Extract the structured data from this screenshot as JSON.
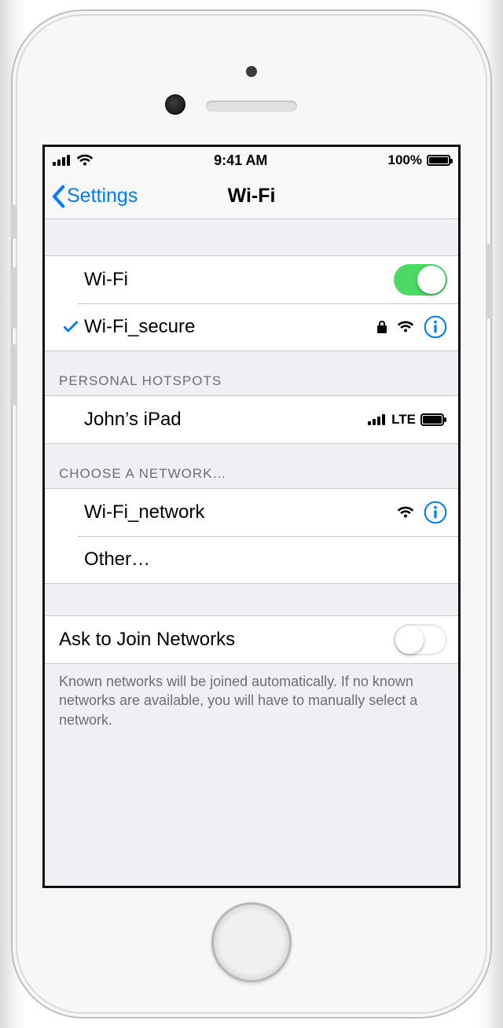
{
  "status_bar": {
    "time": "9:41 AM",
    "battery_percent": "100%"
  },
  "nav": {
    "back_label": "Settings",
    "title": "Wi-Fi"
  },
  "wifi_toggle": {
    "label": "Wi-Fi",
    "on": true
  },
  "connected_network": {
    "name": "Wi-Fi_secure",
    "secured": true
  },
  "personal_hotspots": {
    "header": "Personal Hotspots",
    "items": [
      {
        "name": "John’s iPad",
        "tech": "LTE"
      }
    ]
  },
  "choose_network": {
    "header": "Choose a Network…",
    "items": [
      {
        "name": "Wi-Fi_network",
        "secured": false
      }
    ],
    "other_label": "Other…"
  },
  "ask_to_join": {
    "label": "Ask to Join Networks",
    "on": false,
    "footer": "Known networks will be joined automatically. If no known networks are available, you will have to manually select a network."
  }
}
